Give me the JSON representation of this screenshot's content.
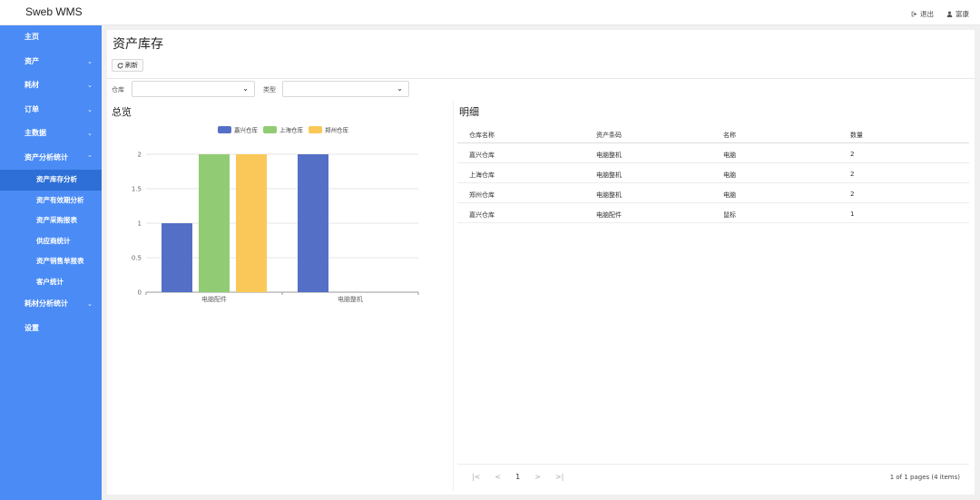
{
  "app": {
    "title": "Sweb WMS"
  },
  "header": {
    "logout_label": "退出",
    "user_label": "富康"
  },
  "sidebar": {
    "items": [
      {
        "label": "主页",
        "chevron": ""
      },
      {
        "label": "资产",
        "chevron": "⌄"
      },
      {
        "label": "耗材",
        "chevron": "⌄"
      },
      {
        "label": "订单",
        "chevron": "⌄"
      },
      {
        "label": "主数据",
        "chevron": "⌄"
      },
      {
        "label": "资产分析统计",
        "chevron": "⌃"
      }
    ],
    "subitems": [
      {
        "label": "资产库存分析",
        "active": true
      },
      {
        "label": "资产有效期分析",
        "active": false
      },
      {
        "label": "资产采购报表",
        "active": false
      },
      {
        "label": "供应商统计",
        "active": false
      },
      {
        "label": "资产销售单报表",
        "active": false
      },
      {
        "label": "客户统计",
        "active": false
      }
    ],
    "bottom_items": [
      {
        "label": "耗材分析统计",
        "chevron": "⌄"
      },
      {
        "label": "设置",
        "chevron": ""
      }
    ]
  },
  "page": {
    "title": "资产库存",
    "refresh_label": "刷新",
    "warehouse_label": "仓库",
    "warehouse_value": "",
    "type_label": "类型",
    "type_value": ""
  },
  "overview": {
    "title": "总览"
  },
  "detail": {
    "title": "明细",
    "columns": [
      "仓库名称",
      "资产条码",
      "名称",
      "数量"
    ],
    "rows": [
      [
        "嘉兴仓库",
        "电脑整机",
        "电脑",
        "2"
      ],
      [
        "上海仓库",
        "电脑整机",
        "电脑",
        "2"
      ],
      [
        "郑州仓库",
        "电脑整机",
        "电脑",
        "2"
      ],
      [
        "嘉兴仓库",
        "电脑配件",
        "鼠标",
        "1"
      ]
    ]
  },
  "pagination": {
    "current_page": "1",
    "info": "1 of 1 pages (4 items)"
  },
  "chart_data": {
    "type": "bar",
    "categories": [
      "电脑配件",
      "电脑整机"
    ],
    "series": [
      {
        "name": "嘉兴仓库",
        "color": "#5470c6",
        "values": [
          1,
          2
        ]
      },
      {
        "name": "上海仓库",
        "color": "#91cc75",
        "values": [
          2,
          0
        ]
      },
      {
        "name": "郑州仓库",
        "color": "#fac858",
        "values": [
          2,
          0
        ]
      }
    ],
    "yticks": [
      0,
      0.5,
      1,
      1.5,
      2
    ],
    "ylim": [
      0,
      2
    ],
    "grid": true,
    "legend": "top-center"
  }
}
